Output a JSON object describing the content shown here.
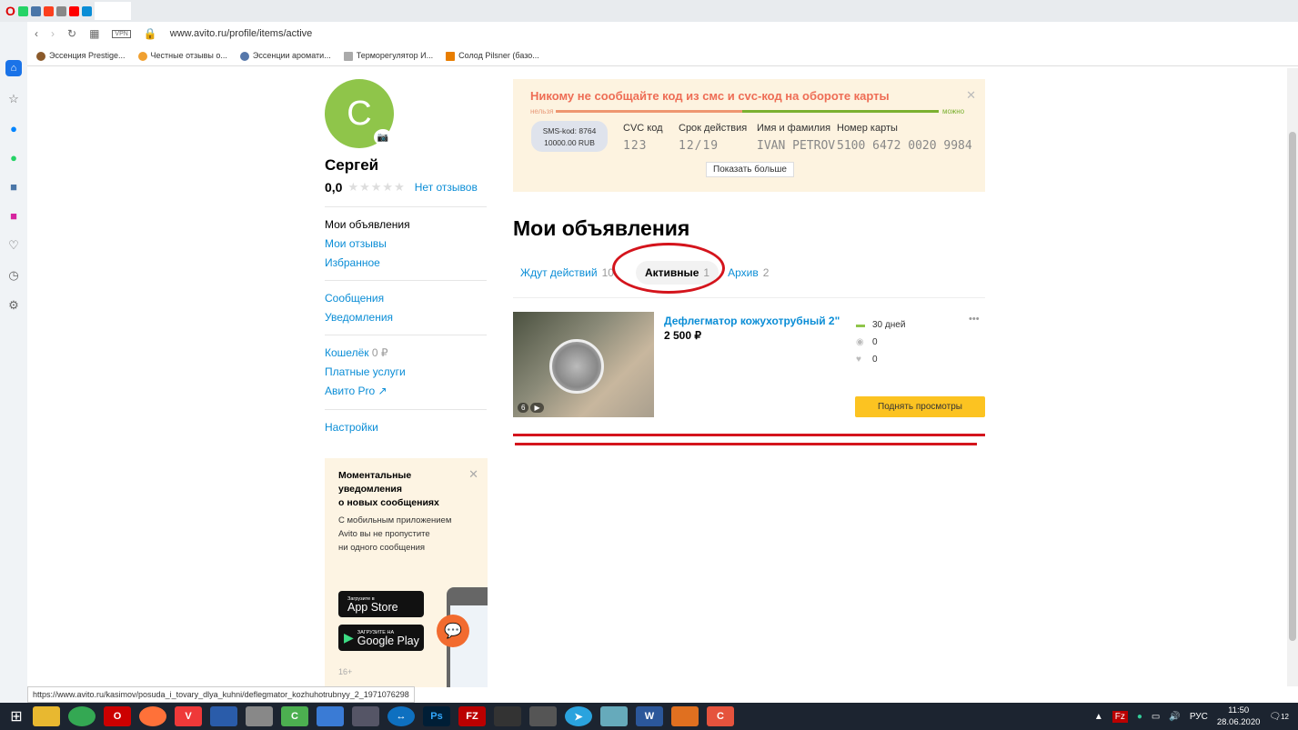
{
  "browser": {
    "url": "www.avito.ru/profile/items/active",
    "vpn_label": "VPN",
    "bookmarks": [
      "Эссенция Prestige...",
      "Честные отзывы о...",
      "Эссенции аромати...",
      "Терморегулятор И...",
      "Солод Pilsner (базо..."
    ],
    "status_url": "https://www.avito.ru/kasimov/posuda_i_tovary_dlya_kuhni/deflegmator_kozhuhotrubnyy_2_1971076298"
  },
  "profile": {
    "initial": "С",
    "name": "Сергей",
    "rating": "0,0",
    "reviews_link": "Нет отзывов"
  },
  "menu": {
    "group1": [
      "Мои объявления",
      "Мои отзывы",
      "Избранное"
    ],
    "group2": [
      "Сообщения",
      "Уведомления"
    ],
    "wallet_label": "Кошелёк",
    "wallet_value": "0 ₽",
    "paid": "Платные услуги",
    "pro": "Авито Pro ↗",
    "settings": "Настройки"
  },
  "promo": {
    "title": [
      "Моментальные",
      "уведомления",
      "о новых сообщениях"
    ],
    "text": [
      "С мобильным приложением",
      "Avito вы не пропустите",
      "ни одного сообщения"
    ],
    "appstore_small": "Загрузите в",
    "appstore_big": "App Store",
    "gplay_small": "ЗАГРУЗИТЕ НА",
    "gplay_big": "Google Play",
    "age": "16+"
  },
  "warning": {
    "title": "Никому не сообщайте код из смс и cvc-код на обороте карты",
    "bad": "нельзя",
    "good": "можно",
    "sms_line1": "SMS-kod: 8764",
    "sms_line2": "10000.00 RUB",
    "cvc_label": "CVC код",
    "cvc_value": "123",
    "exp_label": "Срок действия",
    "exp_value": "12/19",
    "name_label": "Имя и фамилия",
    "name_value": "IVAN PETROV",
    "card_label": "Номер карты",
    "card_value": "5100 6472 0020 9984",
    "more_button": "Показать больше"
  },
  "main": {
    "title": "Мои объявления",
    "tabs": [
      {
        "label": "Ждут действий",
        "count": "10"
      },
      {
        "label": "Активные",
        "count": "1",
        "active": true
      },
      {
        "label": "Архив",
        "count": "2"
      }
    ],
    "item": {
      "title": "Дефлегматор кожухотрубный 2\"",
      "price": "2 500 ₽",
      "photo_count": "6",
      "days": "30 дней",
      "views": "0",
      "favorites": "0",
      "raise_button": "Поднять просмотры"
    }
  },
  "taskbar": {
    "lang": "РУС",
    "time": "11:50",
    "date": "28.06.2020",
    "notifications": "12"
  },
  "colors": {
    "link": "#0a8dd6",
    "annotation": "#d4141c",
    "raise": "#fcc321",
    "avatar": "#8fc54a"
  }
}
